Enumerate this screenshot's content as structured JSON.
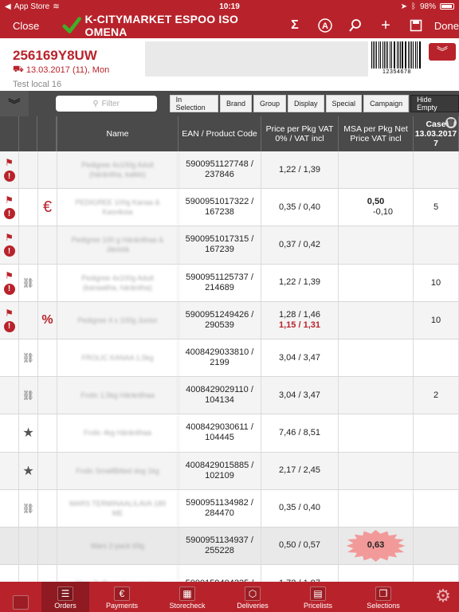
{
  "status": {
    "carrier": "App Store",
    "time": "10:19",
    "battery": "98%"
  },
  "nav": {
    "close": "Close",
    "title": "K-CITYMARKET ESPOO ISO OMENA",
    "sigma": "Σ",
    "done": "Done"
  },
  "order": {
    "number": "256169Y8UW",
    "date": "13.03.2017 (11), Mon",
    "note": "Test local 16",
    "barcode_digits": "12354678"
  },
  "filter": {
    "placeholder": "Filter",
    "buttons": [
      "In Selection",
      "Brand",
      "Group",
      "Display",
      "Special",
      "Campaign",
      "Hide Empty"
    ]
  },
  "columns": {
    "name": "Name",
    "ean": "EAN / Product Code",
    "price": "Price per Pkg VAT 0% / VAT incl",
    "msa": "MSA per Pkg Net Price VAT incl",
    "case_line1": "Case",
    "case_line2": "13.03.2017"
  },
  "rows": [
    {
      "name": "Pedigree 4x100g Adult (häränliha, kalkki)",
      "ean": "5900951127748 /",
      "code": "237846",
      "price": "1,22 / 1,39",
      "price2": "",
      "msa": "",
      "msa2": "",
      "case": "",
      "flag": true,
      "alert": true,
      "link": false,
      "star": false,
      "euro": false,
      "percent": false,
      "burst": ""
    },
    {
      "name": "PEDIGREE 100g Kanaa & Kasviksia",
      "ean": "5900951017322 /",
      "code": "167238",
      "price": "0,35 / 0,40",
      "price2": "",
      "msa": "0,50",
      "msa2": "-0,10",
      "case": "5",
      "flag": true,
      "alert": true,
      "link": false,
      "star": false,
      "euro": true,
      "percent": false,
      "burst": ""
    },
    {
      "name": "Pedigree 100 g Häränlihaa & Jänistä",
      "ean": "5900951017315 /",
      "code": "167239",
      "price": "0,37 / 0,42",
      "price2": "",
      "msa": "",
      "msa2": "",
      "case": "",
      "flag": true,
      "alert": true,
      "link": false,
      "star": false,
      "euro": false,
      "percent": false,
      "burst": ""
    },
    {
      "name": "Pedigree 4x100g Adult (kanaaliha, häränliha)",
      "ean": "5900951125737 /",
      "code": "214689",
      "price": "1,22 / 1,39",
      "price2": "",
      "msa": "",
      "msa2": "",
      "case": "10",
      "flag": true,
      "alert": true,
      "link": true,
      "star": false,
      "euro": false,
      "percent": false,
      "burst": ""
    },
    {
      "name": "Pedigree 4 x 100g Junior",
      "ean": "5900951249426 /",
      "code": "290539",
      "price": "1,28 / 1,46",
      "price2": "1,15 / 1,31",
      "msa": "",
      "msa2": "",
      "case": "10",
      "flag": true,
      "alert": true,
      "link": false,
      "star": false,
      "euro": false,
      "percent": true,
      "burst": ""
    },
    {
      "name": "FROLIC KANAA 1,5kg",
      "ean": "4008429033810 /",
      "code": "2199",
      "price": "3,04 / 3,47",
      "price2": "",
      "msa": "",
      "msa2": "",
      "case": "",
      "flag": false,
      "alert": false,
      "link": true,
      "star": false,
      "euro": false,
      "percent": false,
      "burst": ""
    },
    {
      "name": "Frolic 1,5kg Häränlihaa",
      "ean": "4008429029110 /",
      "code": "104134",
      "price": "3,04 / 3,47",
      "price2": "",
      "msa": "",
      "msa2": "",
      "case": "2",
      "flag": false,
      "alert": false,
      "link": true,
      "star": false,
      "euro": false,
      "percent": false,
      "burst": ""
    },
    {
      "name": "Frolic 4kg Häränlihaa",
      "ean": "4008429030611 /",
      "code": "104445",
      "price": "7,46 / 8,51",
      "price2": "",
      "msa": "",
      "msa2": "",
      "case": "",
      "flag": false,
      "alert": false,
      "link": false,
      "star": true,
      "euro": false,
      "percent": false,
      "burst": ""
    },
    {
      "name": "Frolic SmallBitted dog 1kg",
      "ean": "4008429015885 /",
      "code": "102109",
      "price": "2,17 / 2,45",
      "price2": "",
      "msa": "",
      "msa2": "",
      "case": "",
      "flag": false,
      "alert": false,
      "link": false,
      "star": true,
      "euro": false,
      "percent": false,
      "burst": ""
    },
    {
      "name": "MARS TERMINAALILAVA 189 ME",
      "ean": "5900951134982 /",
      "code": "284470",
      "price": "0,35 / 0,40",
      "price2": "",
      "msa": "",
      "msa2": "",
      "case": "",
      "flag": false,
      "alert": false,
      "link": true,
      "star": false,
      "euro": false,
      "percent": false,
      "burst": ""
    },
    {
      "name": "Mars 2-pack 69g",
      "ean": "5900951134937 /",
      "code": "255228",
      "price": "0,50 / 0,57",
      "price2": "",
      "msa": "",
      "msa2": "",
      "case": "",
      "flag": false,
      "alert": false,
      "link": false,
      "star": false,
      "euro": false,
      "percent": false,
      "burst": "0,63"
    },
    {
      "name": "Mars Buffia suklaapatukka",
      "ean": "5000159404235 /",
      "code": "",
      "price": "1,72 / 1,97",
      "price2": "",
      "msa": "",
      "msa2": "",
      "case": "",
      "flag": false,
      "alert": false,
      "link": false,
      "star": false,
      "euro": false,
      "percent": false,
      "burst": ""
    }
  ],
  "tabs": [
    "Orders",
    "Payments",
    "Storecheck",
    "Deliveries",
    "Pricelists",
    "Selections"
  ],
  "colors": {
    "brand": "#b8232b",
    "header": "#4a4a4a",
    "burst": "#f29a9a"
  }
}
